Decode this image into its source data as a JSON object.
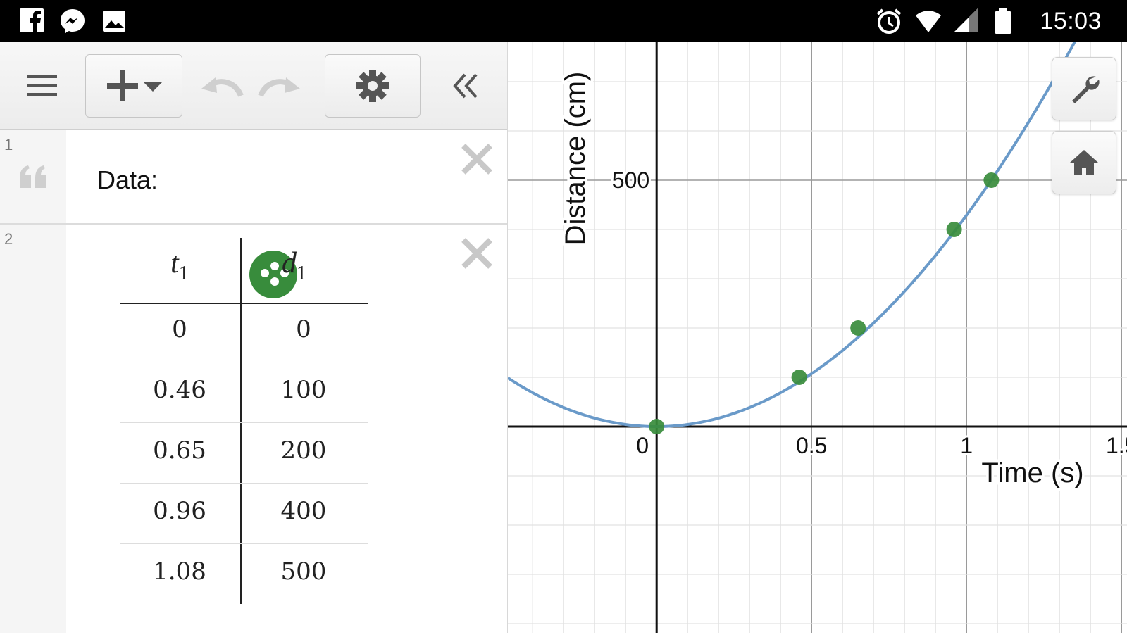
{
  "status_bar": {
    "time": "15:03",
    "left_icons": [
      "facebook-icon",
      "messenger-icon",
      "gallery-icon"
    ],
    "right_icons": [
      "alarm-icon",
      "wifi-icon",
      "signal-icon",
      "battery-icon"
    ]
  },
  "toolbar": {
    "buttons": [
      "menu-icon",
      "add-item-icon",
      "undo-icon",
      "redo-icon",
      "settings-icon",
      "collapse-icon"
    ]
  },
  "expressions": [
    {
      "index": "1",
      "type": "note",
      "text": "Data:"
    },
    {
      "index": "2",
      "type": "table",
      "columns": [
        {
          "var": "t",
          "sub": "1"
        },
        {
          "var": "d",
          "sub": "1"
        }
      ],
      "rows": [
        [
          "0",
          "0"
        ],
        [
          "0.46",
          "100"
        ],
        [
          "0.65",
          "200"
        ],
        [
          "0.96",
          "400"
        ],
        [
          "1.08",
          "500"
        ]
      ],
      "point_color": "#388c3c"
    }
  ],
  "graph": {
    "x_axis_label": "Time (s)",
    "y_axis_label": "Distance (cm)",
    "x_tick_labels": [
      "0",
      "0.5",
      "1",
      "1.5"
    ],
    "y_tick_labels": [
      "500"
    ],
    "curve_color": "#6a9ac9",
    "side_buttons": [
      "wrench-icon",
      "home-icon"
    ]
  },
  "chart_data": {
    "type": "scatter",
    "series": [
      {
        "x": [
          0,
          0.46,
          0.65,
          0.96,
          1.08
        ],
        "y": [
          0,
          100,
          200,
          400,
          500
        ]
      }
    ],
    "fit_curve": "y = 429x^2",
    "xlabel": "Time (s)",
    "ylabel": "Distance (cm)",
    "xlim": [
      -0.48,
      1.52
    ],
    "ylim": [
      -420,
      780
    ],
    "x_minor_step": 0.1,
    "x_major_step": 0.5,
    "y_minor_step": 100,
    "y_major_step": 500,
    "grid": true
  }
}
